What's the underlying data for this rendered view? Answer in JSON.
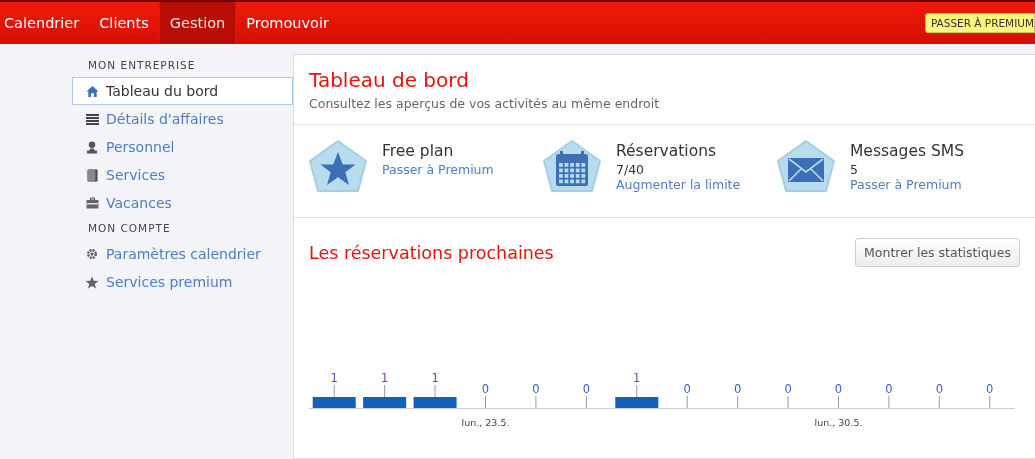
{
  "topbar": {
    "tabs": [
      {
        "label": "Calendrier",
        "selected": false
      },
      {
        "label": "Clients",
        "selected": false
      },
      {
        "label": "Gestion",
        "selected": true
      },
      {
        "label": "Promouvoir",
        "selected": false
      }
    ],
    "premium_badge": "PASSER À PREMIUM"
  },
  "sidebar": {
    "sections": [
      {
        "heading": "MON ENTREPRISE",
        "items": [
          {
            "label": "Tableau du bord",
            "selected": true
          },
          {
            "label": "Détails d'affaires",
            "selected": false
          },
          {
            "label": "Personnel",
            "selected": false
          },
          {
            "label": "Services",
            "selected": false
          },
          {
            "label": "Vacances",
            "selected": false
          }
        ]
      },
      {
        "heading": "MON COMPTE",
        "items": [
          {
            "label": "Paramètres calendrier",
            "selected": false
          },
          {
            "label": "Services premium",
            "selected": false
          }
        ]
      }
    ]
  },
  "dashboard": {
    "title": "Tableau de bord",
    "subtitle": "Consultez les aperçus de vos activités au même endroit",
    "stats": [
      {
        "kind": "plan",
        "title": "Free plan",
        "link": "Passer à Premium"
      },
      {
        "kind": "calendar",
        "title": "Réservations",
        "value": "7/40",
        "link": "Augmenter la limite"
      },
      {
        "kind": "mail",
        "title": "Messages SMS",
        "value": "5",
        "link": "Passer à Premium"
      }
    ],
    "upcoming": {
      "title": "Les réservations prochaines",
      "button": "Montrer les statistiques",
      "chart_data": {
        "type": "bar",
        "values": [
          1,
          1,
          1,
          0,
          0,
          0,
          1,
          0,
          0,
          0,
          0,
          0,
          0,
          0
        ],
        "categories": [
          null,
          null,
          null,
          "lun., 23.5.",
          null,
          null,
          null,
          null,
          null,
          null,
          "lun., 30.5.",
          null,
          null,
          null
        ],
        "data_labels": true
      }
    }
  }
}
